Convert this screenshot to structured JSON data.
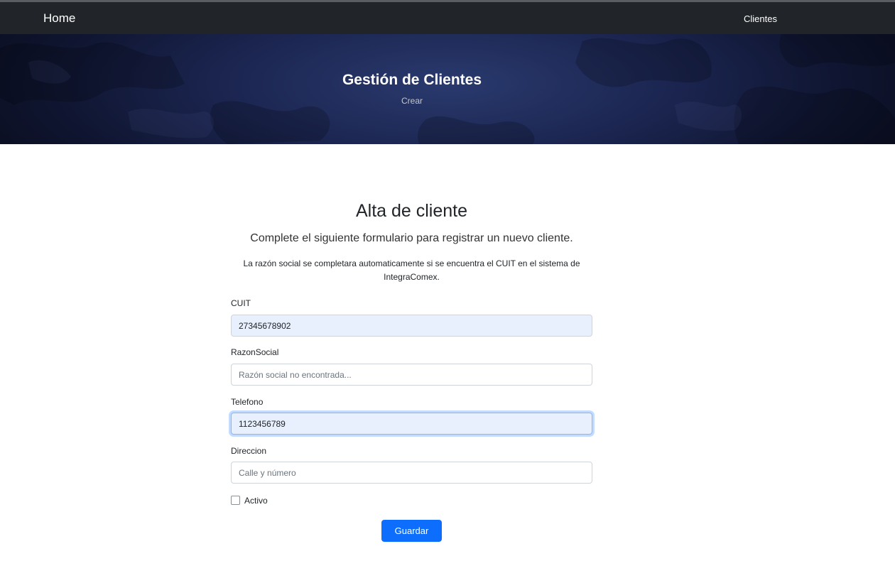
{
  "navbar": {
    "brand": "Home",
    "links": [
      "Clientes"
    ]
  },
  "hero": {
    "title": "Gestión de Clientes",
    "subtitle": "Crear"
  },
  "form": {
    "title": "Alta de cliente",
    "lead": "Complete el siguiente formulario para registrar un nuevo cliente.",
    "note": "La razón social se completara automaticamente si se encuentra el CUIT en el sistema de IntegraComex.",
    "fields": {
      "cuit": {
        "label": "CUIT",
        "value": "27345678902",
        "placeholder": ""
      },
      "razon_social": {
        "label": "RazonSocial",
        "value": "",
        "placeholder": "Razón social no encontrada..."
      },
      "telefono": {
        "label": "Telefono",
        "value": "1123456789",
        "placeholder": ""
      },
      "direccion": {
        "label": "Direccion",
        "value": "",
        "placeholder": "Calle y número"
      }
    },
    "activo": {
      "label": "Activo",
      "checked": false
    },
    "submit_label": "Guardar"
  },
  "colors": {
    "navbar": "#212529",
    "primary": "#0d6efd",
    "autofill": "#e8f0fe",
    "hero_dark": "#0f1530"
  }
}
